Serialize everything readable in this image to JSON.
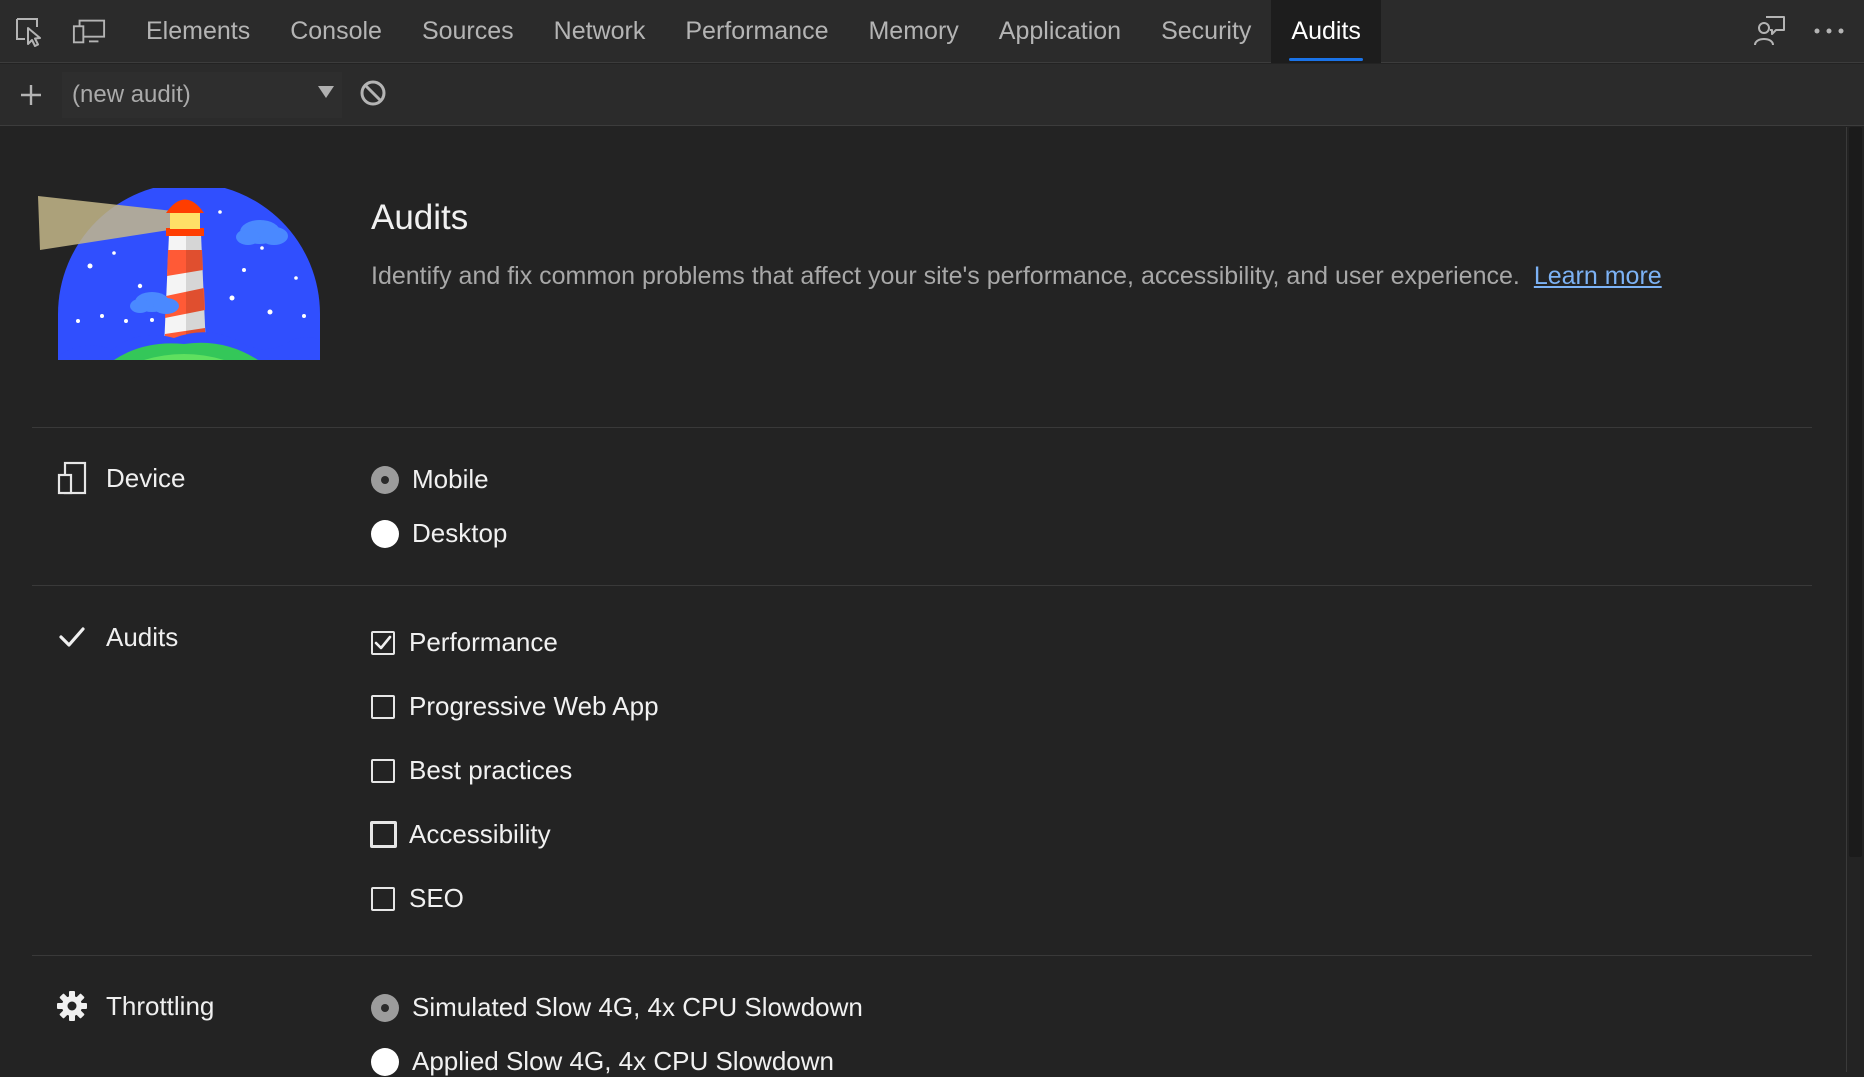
{
  "tabbar": {
    "inspect_icon": "inspect-element-icon",
    "device_icon": "device-emulation-icon",
    "tabs": [
      {
        "label": "Elements",
        "active": false
      },
      {
        "label": "Console",
        "active": false
      },
      {
        "label": "Sources",
        "active": false
      },
      {
        "label": "Network",
        "active": false
      },
      {
        "label": "Performance",
        "active": false
      },
      {
        "label": "Memory",
        "active": false
      },
      {
        "label": "Application",
        "active": false
      },
      {
        "label": "Security",
        "active": false
      },
      {
        "label": "Audits",
        "active": true
      }
    ],
    "feedback_icon": "feedback-icon",
    "more_icon": "more-options-icon",
    "active_color": "#1a73e8"
  },
  "toolbar": {
    "add_icon": "plus-icon",
    "select_value": "(new audit)",
    "clear_icon": "clear-block-icon"
  },
  "hero": {
    "logo": "lighthouse-logo",
    "title": "Audits",
    "description": "Identify and fix common problems that affect your site's performance, accessibility, and user experience.",
    "learn_more": "Learn more",
    "link_color": "#7cb2f5"
  },
  "device": {
    "label": "Device",
    "icon": "device-icon",
    "options": [
      {
        "label": "Mobile",
        "selected": true
      },
      {
        "label": "Desktop",
        "selected": false
      }
    ]
  },
  "audits": {
    "label": "Audits",
    "icon": "checkmark-icon",
    "options": [
      {
        "label": "Performance",
        "checked": true
      },
      {
        "label": "Progressive Web App",
        "checked": false
      },
      {
        "label": "Best practices",
        "checked": false
      },
      {
        "label": "Accessibility",
        "checked": false,
        "focused": true
      },
      {
        "label": "SEO",
        "checked": false
      }
    ]
  },
  "throttling": {
    "label": "Throttling",
    "icon": "gear-icon",
    "options": [
      {
        "label": "Simulated Slow 4G, 4x CPU Slowdown",
        "selected": true
      },
      {
        "label": "Applied Slow 4G, 4x CPU Slowdown",
        "selected": false
      }
    ]
  }
}
